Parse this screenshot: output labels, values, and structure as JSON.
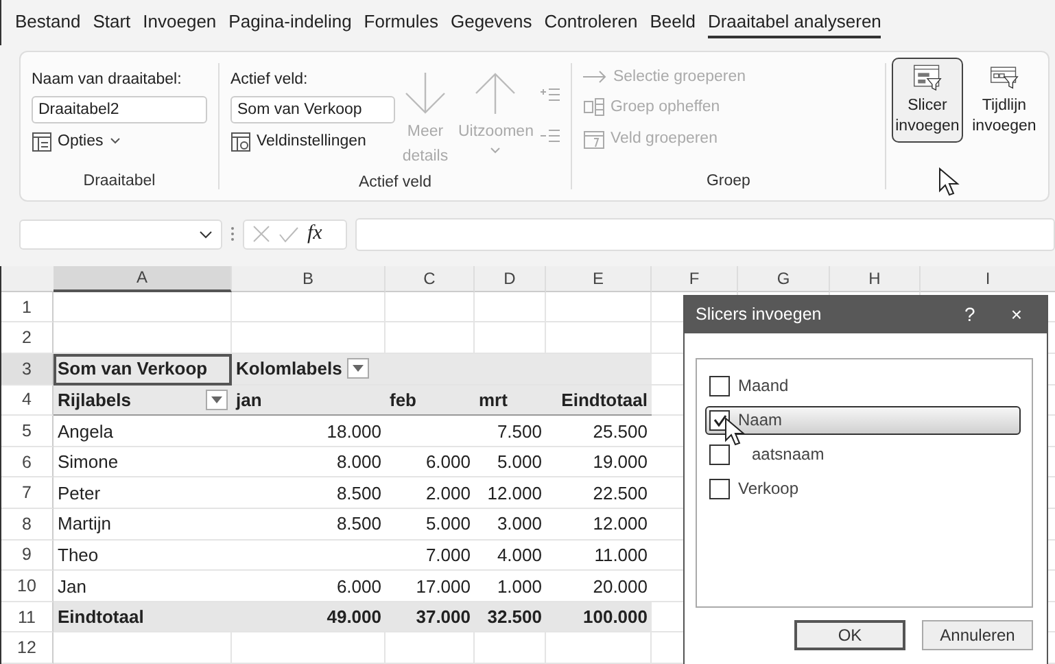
{
  "menu_tabs": [
    {
      "label": "Bestand",
      "selected": false
    },
    {
      "label": "Start",
      "selected": false
    },
    {
      "label": "Invoegen",
      "selected": false
    },
    {
      "label": "Pagina-indeling",
      "selected": false
    },
    {
      "label": "Formules",
      "selected": false
    },
    {
      "label": "Gegevens",
      "selected": false
    },
    {
      "label": "Controleren",
      "selected": false
    },
    {
      "label": "Beeld",
      "selected": false
    },
    {
      "label": "Draaitabel analyseren",
      "selected": true
    }
  ],
  "ribbon": {
    "draaitabel": {
      "name_label": "Naam van draaitabel:",
      "name_value": "Draaitabel2",
      "options_button": "Opties",
      "group_label": "Draaitabel"
    },
    "actief_veld": {
      "field_label": "Actief veld:",
      "field_value": "Som van Verkoop",
      "settings_button": "Veldinstellingen",
      "drill_down": {
        "label": "Meer details",
        "disabled": true
      },
      "drill_up": {
        "label": "Uitzoomen",
        "disabled": true
      },
      "group_label": "Actief veld"
    },
    "groep": {
      "items": [
        {
          "kind": "arrow",
          "label": "Selectie groeperen",
          "disabled": true
        },
        {
          "kind": "ungroup",
          "label": "Groep opheffen",
          "disabled": true
        },
        {
          "kind": "calendar",
          "label": "Veld groeperen",
          "disabled": true
        }
      ],
      "group_label": "Groep"
    },
    "filter_buttons": [
      {
        "kind": "slicer",
        "label": "Slicer invoegen",
        "hovered": true
      },
      {
        "kind": "timeline",
        "label": "Tijdlijn invoegen",
        "hovered": false
      }
    ]
  },
  "formula_bar": {
    "fx": "fx"
  },
  "sheet": {
    "columns": [
      {
        "label": "A",
        "selected": true
      },
      {
        "label": "B",
        "selected": false
      },
      {
        "label": "C",
        "selected": false
      },
      {
        "label": "D",
        "selected": false
      },
      {
        "label": "E",
        "selected": false
      },
      {
        "label": "F",
        "selected": false
      },
      {
        "label": "G",
        "selected": false
      },
      {
        "label": "H",
        "selected": false
      },
      {
        "label": "I",
        "selected": false
      }
    ],
    "rows": [
      {
        "number": "1",
        "kind": "blank",
        "selected": false,
        "cells": []
      },
      {
        "number": "2",
        "kind": "blank",
        "selected": false,
        "cells": []
      },
      {
        "number": "3",
        "kind": "pivot_title",
        "selected": true,
        "cells": [
          {
            "text": "Som van Verkoop",
            "filter": false
          },
          {
            "text": "Kolomlabels",
            "filter": true
          }
        ]
      },
      {
        "number": "4",
        "kind": "header",
        "selected": false,
        "cells": [
          {
            "text": "Rijlabels",
            "filter": true
          },
          {
            "text": "jan",
            "filter": false
          },
          {
            "text": "feb",
            "filter": false
          },
          {
            "text": "mrt",
            "filter": false
          },
          {
            "text": "Eindtotaal",
            "filter": false
          }
        ]
      },
      {
        "number": "5",
        "kind": "data",
        "selected": false,
        "cells": [
          {
            "text": "Angela"
          },
          {
            "text": "18.000"
          },
          null,
          {
            "text": "7.500"
          },
          {
            "text": "25.500"
          }
        ]
      },
      {
        "number": "6",
        "kind": "data",
        "selected": false,
        "cells": [
          {
            "text": "Simone"
          },
          {
            "text": "8.000"
          },
          {
            "text": "6.000"
          },
          {
            "text": "5.000"
          },
          {
            "text": "19.000"
          }
        ]
      },
      {
        "number": "7",
        "kind": "data",
        "selected": false,
        "cells": [
          {
            "text": "Peter"
          },
          {
            "text": "8.500"
          },
          {
            "text": "2.000"
          },
          {
            "text": "12.000"
          },
          {
            "text": "22.500"
          }
        ]
      },
      {
        "number": "8",
        "kind": "data",
        "selected": false,
        "cells": [
          {
            "text": "Martijn"
          },
          {
            "text": "8.500"
          },
          {
            "text": "5.000"
          },
          {
            "text": "3.000"
          },
          {
            "text": "12.000"
          }
        ]
      },
      {
        "number": "9",
        "kind": "data",
        "selected": false,
        "cells": [
          {
            "text": "Theo"
          },
          null,
          {
            "text": "7.000"
          },
          {
            "text": "4.000"
          },
          {
            "text": "11.000"
          }
        ]
      },
      {
        "number": "10",
        "kind": "data",
        "selected": false,
        "cells": [
          {
            "text": "Jan"
          },
          {
            "text": "6.000"
          },
          {
            "text": "17.000"
          },
          {
            "text": "1.000"
          },
          {
            "text": "20.000"
          }
        ]
      },
      {
        "number": "11",
        "kind": "total",
        "selected": false,
        "cells": [
          {
            "text": "Eindtotaal"
          },
          {
            "text": "49.000"
          },
          {
            "text": "37.000"
          },
          {
            "text": "32.500"
          },
          {
            "text": "100.000"
          }
        ]
      },
      {
        "number": "12",
        "kind": "blank",
        "selected": false,
        "cells": []
      }
    ]
  },
  "dialog": {
    "title": "Slicers invoegen",
    "help": "?",
    "close": "×",
    "fields": [
      {
        "label": "Maand",
        "checked": false,
        "hovered": false
      },
      {
        "label": "Naam",
        "checked": true,
        "hovered": true
      },
      {
        "label": "aatsnaam",
        "checked": false,
        "hovered": false
      },
      {
        "label": "Verkoop",
        "checked": false,
        "hovered": false
      }
    ],
    "buttons": [
      {
        "label": "OK",
        "default": true
      },
      {
        "label": "Annuleren",
        "default": false
      }
    ]
  }
}
